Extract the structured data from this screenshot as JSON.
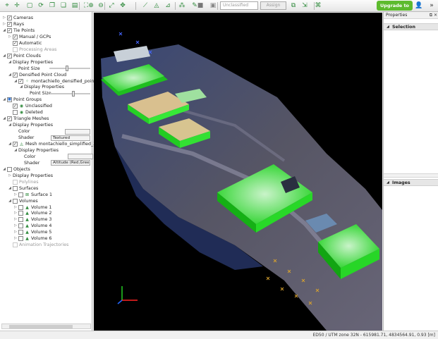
{
  "toolbar": {
    "icons": [
      "select-arrow-icon",
      "crosshair-icon",
      "box-icon",
      "rotate-icon",
      "copy-icon",
      "copy2-icon",
      "document-icon",
      "open-icon",
      "zoom-in-icon",
      "zoom-out-icon",
      "fit-all-icon",
      "expand-icon",
      "measure-icon",
      "mesh-icon",
      "ruler-icon",
      "tie-point-icon",
      "brush-icon",
      "square-icon",
      "color-box-icon",
      "folder-copy-icon",
      "export-icon",
      "share-icon"
    ],
    "class_select_value": "Unclassified",
    "assign_label": "Assign",
    "upgrade_label": "Upgrade to Pro"
  },
  "layers": [
    {
      "label": "Cameras",
      "level": 0,
      "expander": "▷",
      "checked": true
    },
    {
      "label": "Rays",
      "level": 0,
      "expander": "▷",
      "checked": true
    },
    {
      "label": "Tie Points",
      "level": 0,
      "expander": "◢",
      "checked": true
    },
    {
      "label": "Manual / GCPs",
      "level": 1,
      "expander": "▷",
      "checked": true
    },
    {
      "label": "Automatic",
      "level": 1,
      "expander": "",
      "checked": true
    },
    {
      "label": "Processing Areas",
      "level": 1,
      "expander": "",
      "checked": false,
      "disabled": true
    },
    {
      "label": "Point Clouds",
      "level": 0,
      "expander": "◢",
      "checked": true
    },
    {
      "label": "Display Properties",
      "level": 1,
      "expander": "◢",
      "checked": null
    },
    {
      "label": "Point Size",
      "level": 2,
      "expander": "",
      "checked": null,
      "slider": true
    },
    {
      "label": "Densified Point Cloud",
      "level": 1,
      "expander": "◢",
      "checked": true
    },
    {
      "label": "montachiello_densified_point_...",
      "level": 2,
      "expander": "◢",
      "checked": true,
      "icon": "point-cloud-icon"
    },
    {
      "label": "Display Properties",
      "level": 3,
      "expander": "◢",
      "checked": null
    },
    {
      "label": "Point Size",
      "level": 4,
      "expander": "",
      "checked": null,
      "slider": true
    },
    {
      "label": "Point Groups",
      "level": 0,
      "expander": "◢",
      "checked": "mixed"
    },
    {
      "label": "Unclassified",
      "level": 1,
      "expander": "",
      "checked": true,
      "icon": "group-icon"
    },
    {
      "label": "Deleted",
      "level": 1,
      "expander": "",
      "checked": false,
      "icon": "group-icon"
    },
    {
      "label": "Triangle Meshes",
      "level": 0,
      "expander": "◢",
      "checked": true
    },
    {
      "label": "Display Properties",
      "level": 1,
      "expander": "◢",
      "checked": null
    },
    {
      "label": "Color",
      "level": 2,
      "expander": "",
      "checked": null,
      "color_field": true
    },
    {
      "label": "Shader",
      "level": 2,
      "expander": "",
      "checked": null,
      "shader": "Textured"
    },
    {
      "label": "Mesh montachiello_simplified_3d_m...",
      "level": 1,
      "expander": "◢",
      "checked": true,
      "icon": "mesh-icon"
    },
    {
      "label": "Display Properties",
      "level": 2,
      "expander": "◢",
      "checked": null
    },
    {
      "label": "Color",
      "level": 3,
      "expander": "",
      "checked": null,
      "color_field": true
    },
    {
      "label": "Shader",
      "level": 3,
      "expander": "",
      "checked": null,
      "shader": "Altitude (Red,Green,B..."
    },
    {
      "label": "Objects",
      "level": 0,
      "expander": "◢",
      "checked": false
    },
    {
      "label": "Display Properties",
      "level": 1,
      "expander": "▷",
      "checked": null
    },
    {
      "label": "Polylines",
      "level": 1,
      "expander": "",
      "checked": false,
      "disabled": true
    },
    {
      "label": "Surfaces",
      "level": 1,
      "expander": "◢",
      "checked": false
    },
    {
      "label": "Surface 1",
      "level": 2,
      "expander": "▷",
      "checked": false,
      "icon": "surface-icon"
    },
    {
      "label": "Volumes",
      "level": 1,
      "expander": "◢",
      "checked": false
    },
    {
      "label": "Volume 1",
      "level": 2,
      "expander": "▷",
      "checked": false,
      "icon": "volume-icon"
    },
    {
      "label": "Volume 2",
      "level": 2,
      "expander": "▷",
      "checked": false,
      "icon": "volume-icon"
    },
    {
      "label": "Volume 3",
      "level": 2,
      "expander": "▷",
      "checked": false,
      "icon": "volume-icon"
    },
    {
      "label": "Volume 4",
      "level": 2,
      "expander": "▷",
      "checked": false,
      "icon": "volume-icon"
    },
    {
      "label": "Volume 5",
      "level": 2,
      "expander": "▷",
      "checked": false,
      "icon": "volume-icon"
    },
    {
      "label": "Volume 6",
      "level": 2,
      "expander": "▷",
      "checked": false,
      "icon": "volume-icon"
    },
    {
      "label": "Animation Trajectories",
      "level": 1,
      "expander": "",
      "checked": false,
      "disabled": true
    }
  ],
  "properties": {
    "title": "Properties",
    "controls": "⧉ ✕",
    "selection_label": "Selection",
    "images_label": "Images"
  },
  "status": {
    "text": "ED50 / UTM zone 32N - 615981.71, 4834564.91, 0.93 [m]"
  },
  "colors": {
    "accent_green": "#5dbb2e",
    "viewport_bg": "#000000"
  }
}
